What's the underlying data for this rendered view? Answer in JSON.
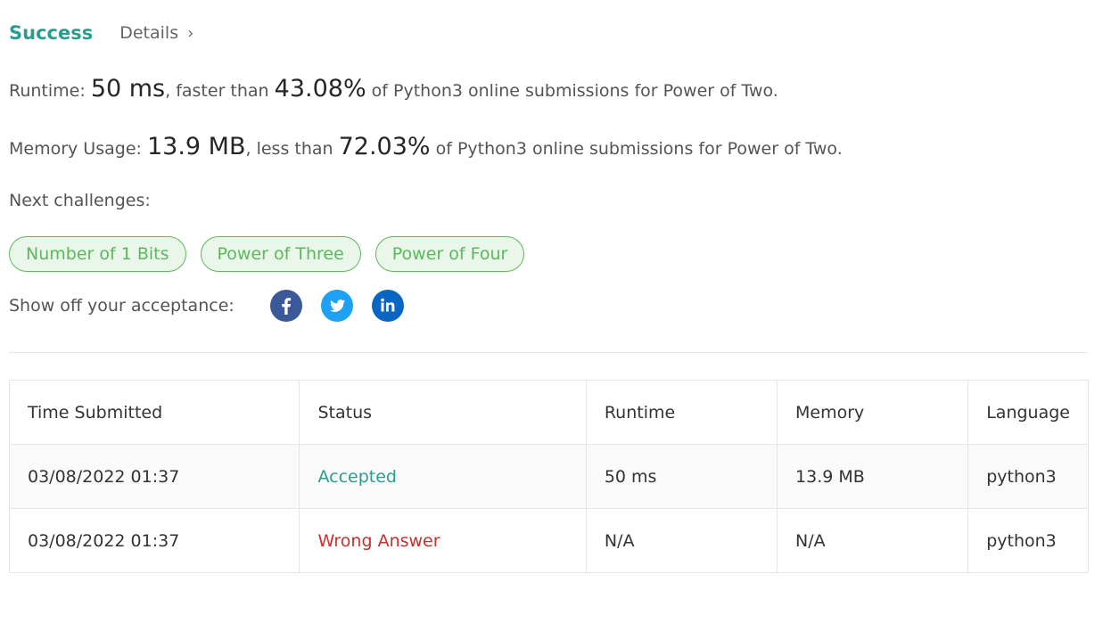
{
  "header": {
    "status": "Success",
    "details_label": "Details",
    "details_chevron": "›"
  },
  "runtime": {
    "label": "Runtime:",
    "value": "50 ms",
    "mid": ", faster than",
    "percent": "43.08%",
    "suffix": "of Python3 online submissions for Power of Two."
  },
  "memory": {
    "label": "Memory Usage:",
    "value": "13.9 MB",
    "mid": ", less than",
    "percent": "72.03%",
    "suffix": "of Python3 online submissions for Power of Two."
  },
  "next": {
    "label": "Next challenges:",
    "items": [
      "Number of 1 Bits",
      "Power of Three",
      "Power of Four"
    ]
  },
  "share": {
    "label": "Show off your acceptance:",
    "icons": [
      "facebook-icon",
      "twitter-icon",
      "linkedin-icon"
    ],
    "colors": {
      "facebook": "#3b5998",
      "twitter": "#1da1f2",
      "linkedin": "#0a66c2"
    }
  },
  "table": {
    "headers": [
      "Time Submitted",
      "Status",
      "Runtime",
      "Memory",
      "Language"
    ],
    "rows": [
      {
        "time": "03/08/2022 01:37",
        "status": "Accepted",
        "runtime": "50 ms",
        "memory": "13.9 MB",
        "language": "python3"
      },
      {
        "time": "03/08/2022 01:37",
        "status": "Wrong Answer",
        "runtime": "N/A",
        "memory": "N/A",
        "language": "python3"
      }
    ]
  },
  "colors": {
    "accepted": "#2a9d8f",
    "wrong": "#c9302c",
    "chip_border": "#5cb85c",
    "chip_bg": "#eaf6ea"
  }
}
